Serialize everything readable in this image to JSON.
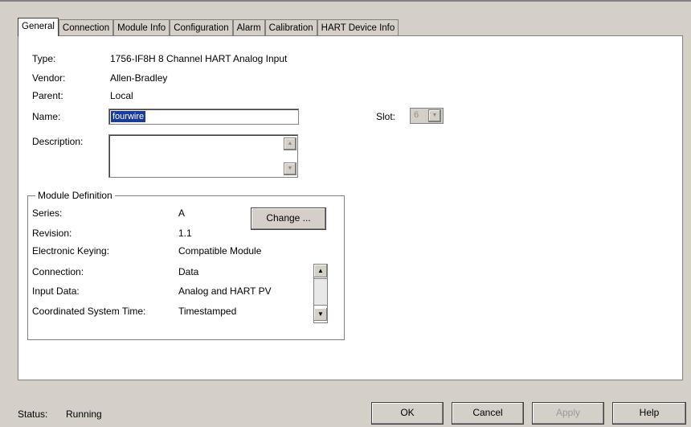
{
  "tabs": [
    "General",
    "Connection",
    "Module Info",
    "Configuration",
    "Alarm",
    "Calibration",
    "HART Device Info"
  ],
  "general": {
    "type_label": "Type:",
    "type_value": "1756-IF8H 8 Channel HART Analog Input",
    "vendor_label": "Vendor:",
    "vendor_value": "Allen-Bradley",
    "parent_label": "Parent:",
    "parent_value": "Local",
    "name_label": "Name:",
    "name_value": "fourwire",
    "slot_label": "Slot:",
    "slot_value": "6",
    "description_label": "Description:",
    "description_value": ""
  },
  "module_definition": {
    "title": "Module Definition",
    "change_label": "Change ...",
    "rows": [
      {
        "label": "Series:",
        "value": "A"
      },
      {
        "label": "Revision:",
        "value": "1.1"
      },
      {
        "label": "Electronic Keying:",
        "value": "Compatible Module"
      },
      {
        "label": "Connection:",
        "value": "Data"
      },
      {
        "label": "Input Data:",
        "value": "Analog and HART PV"
      },
      {
        "label": "Coordinated System Time:",
        "value": "Timestamped"
      }
    ]
  },
  "status": {
    "label": "Status:",
    "value": "Running"
  },
  "buttons": {
    "ok": "OK",
    "cancel": "Cancel",
    "apply": "Apply",
    "help": "Help"
  }
}
